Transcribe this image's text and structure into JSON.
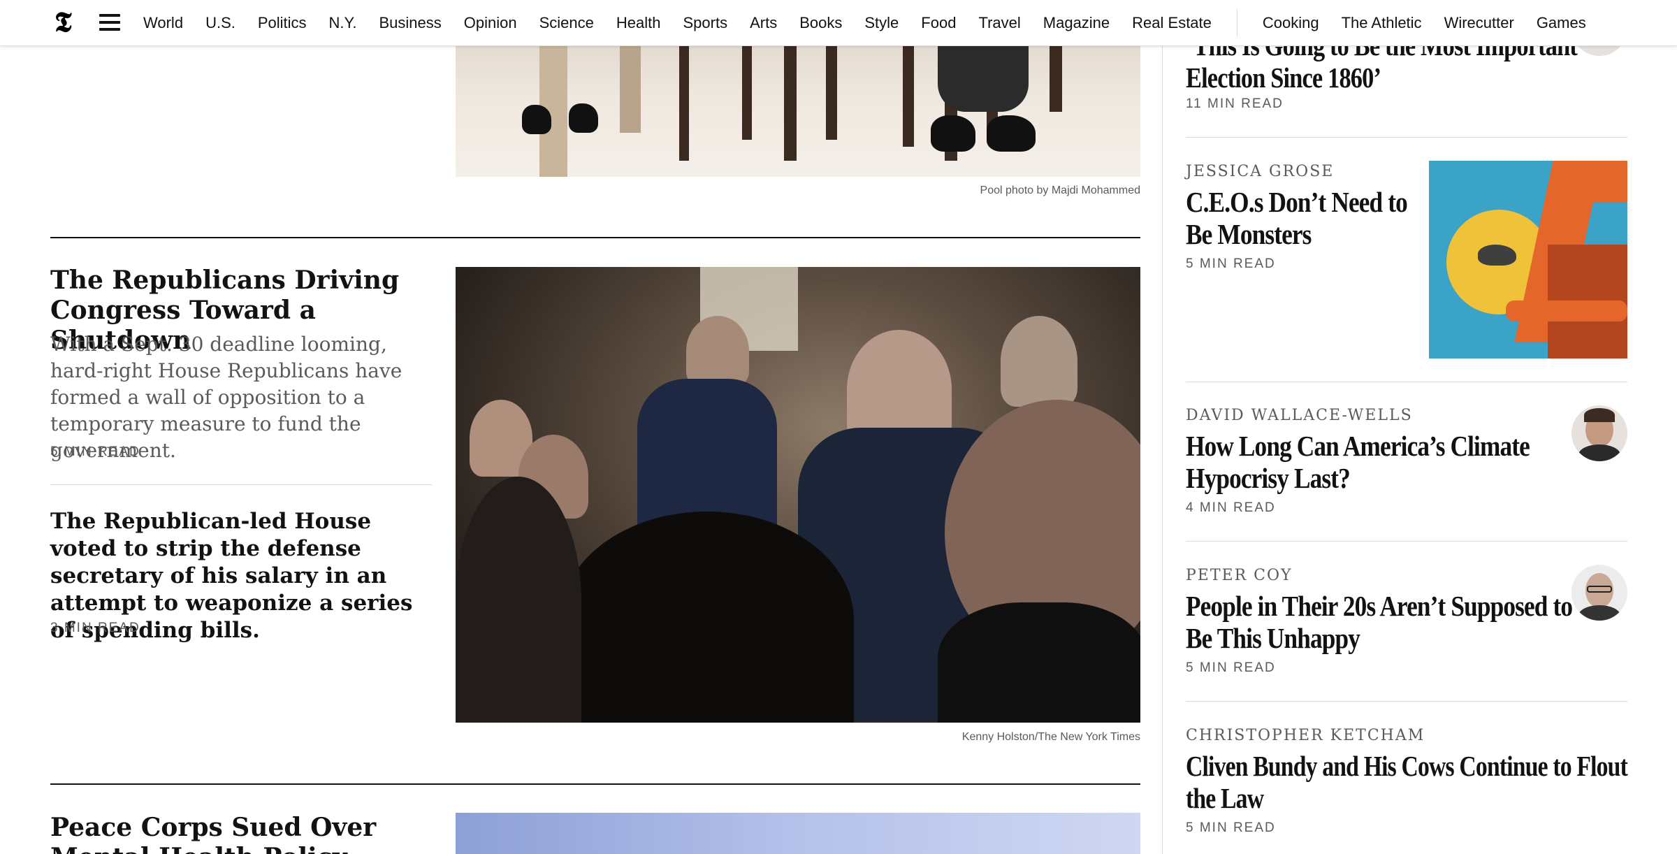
{
  "nav": {
    "logo": "𝕿",
    "sections": [
      "World",
      "U.S.",
      "Politics",
      "N.Y.",
      "Business",
      "Opinion",
      "Science",
      "Health",
      "Sports",
      "Arts",
      "Books",
      "Style",
      "Food",
      "Travel",
      "Magazine",
      "Real Estate"
    ],
    "products": [
      "Cooking",
      "The Athletic",
      "Wirecutter",
      "Games"
    ]
  },
  "left": {
    "top_photo_caption": "Pool photo by Majdi Mohammed",
    "story1": {
      "headline": "The Republicans Driving Congress Toward a Shutdown",
      "summary": "With a Sept. 30 deadline looming, hard-right House Republicans have formed a wall of opposition to a temporary measure to fund the government.",
      "read_time": "5 MIN READ"
    },
    "story2": {
      "headline": "The Republican-led House voted to strip the defense secretary of his salary in an attempt to weaponize a series of spending bills.",
      "read_time": "3 MIN READ"
    },
    "main_photo_caption": "Kenny Holston/The New York Times",
    "story3": {
      "headline": "Peace Corps Sued Over Mental Health Policy"
    }
  },
  "opinion": {
    "item0": {
      "headline_line1": "‘This Is Going to Be the Most Important",
      "headline_line2": "Election Since 1860’",
      "read_time": "11 MIN READ"
    },
    "item1": {
      "author": "JESSICA GROSE",
      "headline_line1": "C.E.O.s Don’t Need to",
      "headline_line2": "Be Monsters",
      "read_time": "5 MIN READ"
    },
    "item2": {
      "author": "DAVID WALLACE-WELLS",
      "headline_line1": "How Long Can America’s Climate",
      "headline_line2": "Hypocrisy Last?",
      "read_time": "4 MIN READ"
    },
    "item3": {
      "author": "PETER COY",
      "headline_line1": "People in Their 20s Aren’t Supposed to",
      "headline_line2": "Be This Unhappy",
      "read_time": "5 MIN READ"
    },
    "item4": {
      "author": "CHRISTOPHER KETCHAM",
      "headline_line1": "Cliven Bundy and His Cows Continue to Flout",
      "headline_line2": "the Law",
      "read_time": "5 MIN READ"
    }
  },
  "colors": {
    "text": "#121212",
    "secondary": "#5a5a5a",
    "rule": "#dcdcdc",
    "illustration_bg": "#3aa3c7",
    "illustration_orange": "#e5662a"
  }
}
